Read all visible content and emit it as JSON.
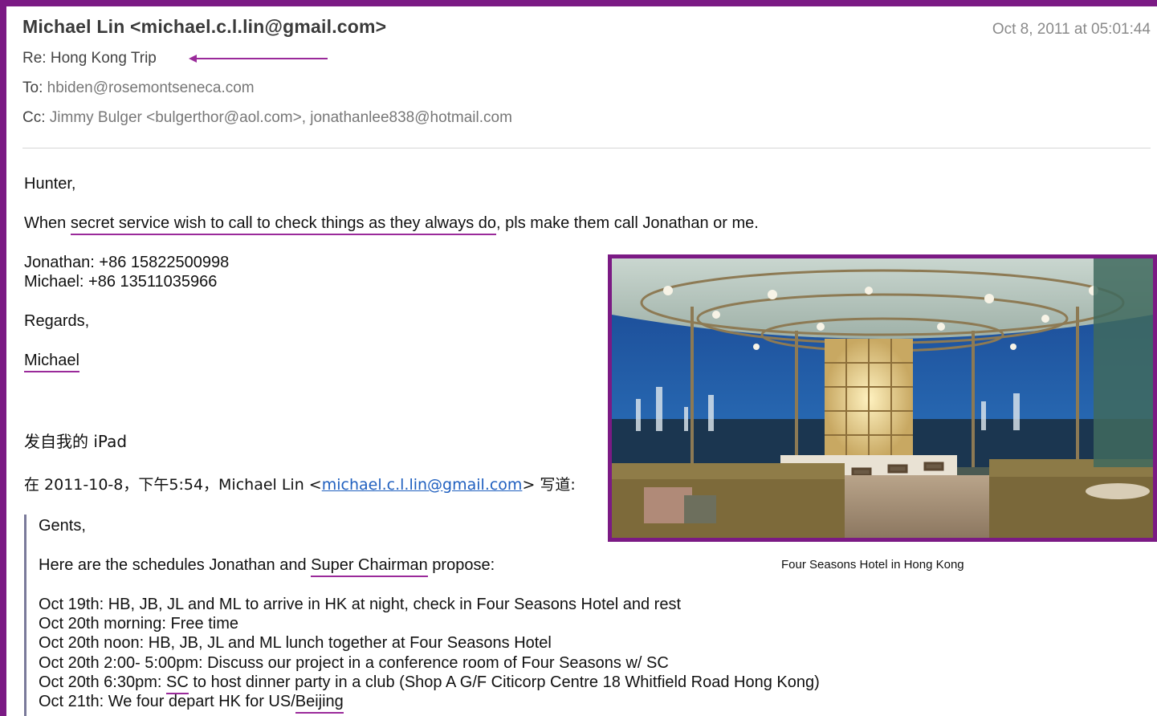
{
  "header": {
    "from": "Michael Lin <michael.c.l.lin@gmail.com>",
    "date": "Oct 8, 2011 at 05:01:44",
    "subject": "Re: Hong Kong Trip",
    "to_label": "To:",
    "to_value": "hbiden@rosemontseneca.com",
    "cc_label": "Cc:",
    "cc_value": "Jimmy Bulger <bulgerthor@aol.com>, jonathanlee838@hotmail.com"
  },
  "body": {
    "greeting": "Hunter,",
    "line1_pre": "When ",
    "line1_underlined": "secret service wish to call to check things as they always do",
    "line1_post": ", pls make them call Jonathan or me.",
    "contact1": "Jonathan: +86 15822500998",
    "contact2": "Michael: +86 13511035966",
    "regards": "Regards,",
    "signature": "Michael",
    "sent_from": "发自我的 iPad",
    "quote_intro_pre": "在 2011-10-8，下午5:54，Michael Lin <",
    "quote_intro_link": "michael.c.l.lin@gmail.com",
    "quote_intro_post": "> 写道:"
  },
  "quoted": {
    "greeting": "Gents,",
    "intro_pre": "Here are the schedules Jonathan and ",
    "intro_underlined": "Super Chairman",
    "intro_post": " propose:",
    "schedule": [
      "Oct 19th:  HB, JB, JL and ML to arrive in HK at night, check in Four Seasons Hotel and rest",
      "Oct 20th morning: Free time",
      "Oct 20th noon: HB, JB, JL and ML lunch together at Four Seasons Hotel",
      "Oct 20th 2:00- 5:00pm: Discuss our project in a conference room of Four Seasons w/ SC"
    ],
    "line5_pre": "Oct 20th 6:30pm: ",
    "line5_underlined": "SC",
    "line5_post": " to host dinner party in a club (Shop A G/F Citicorp Centre 18 Whitfield Road Hong Kong)",
    "line6_pre": "Oct 21th: We four depart HK for US/",
    "line6_underlined": "Beijing"
  },
  "photo": {
    "caption": "Four Seasons Hotel in Hong Kong"
  },
  "colors": {
    "frame": "#7b1a84",
    "underline": "#9a2a9a",
    "link": "#1f5fbf"
  }
}
